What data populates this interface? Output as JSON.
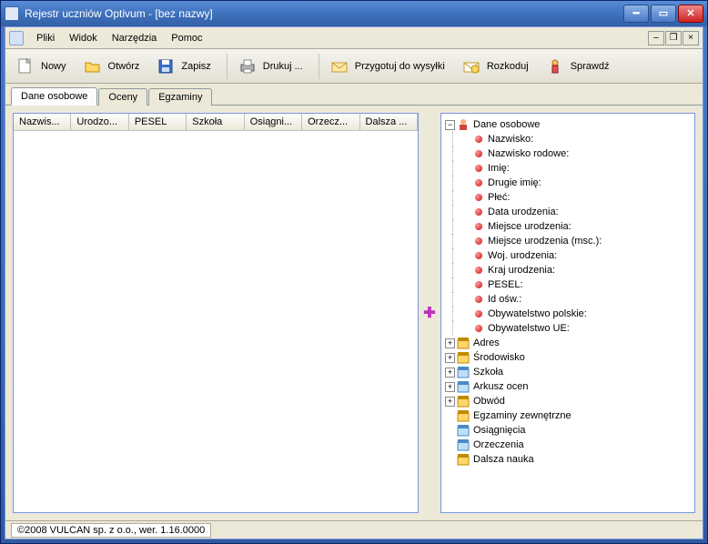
{
  "window": {
    "title": "Rejestr uczniów Optivum - [bez nazwy]"
  },
  "menu": {
    "items": [
      "Pliki",
      "Widok",
      "Narzędzia",
      "Pomoc"
    ]
  },
  "toolbar": {
    "nowy": "Nowy",
    "otworz": "Otwórz",
    "zapisz": "Zapisz",
    "drukuj": "Drukuj ...",
    "przygotuj": "Przygotuj do wysyłki",
    "rozkoduj": "Rozkoduj",
    "sprawdz": "Sprawdź"
  },
  "tabs": {
    "t0": "Dane osobowe",
    "t1": "Oceny",
    "t2": "Egzaminy"
  },
  "table": {
    "columns": [
      "Nazwis...",
      "Urodzo...",
      "PESEL",
      "Szkoła",
      "Osiągni...",
      "Orzecz...",
      "Dalsza ..."
    ]
  },
  "tree": {
    "root0": "Dane osobowe",
    "root0_children": [
      "Nazwisko:",
      "Nazwisko rodowe:",
      "Imię:",
      "Drugie imię:",
      "Płeć:",
      "Data urodzenia:",
      "Miejsce urodzenia:",
      "Miejsce urodzenia (msc.):",
      "Woj. urodzenia:",
      "Kraj urodzenia:",
      "PESEL:",
      "Id ośw.:",
      "Obywatelstwo polskie:",
      "Obywatelstwo UE:"
    ],
    "adres": "Adres",
    "srodowisko": "Środowisko",
    "szkola": "Szkoła",
    "arkusz": "Arkusz ocen",
    "obwod": "Obwód",
    "egzaminy": "Egzaminy zewnętrzne",
    "osiagniecia": "Osiągnięcia",
    "orzeczenia": "Orzeczenia",
    "dalsza": "Dalsza nauka"
  },
  "status": {
    "text": "©2008 VULCAN sp. z o.o., wer. 1.16.0000"
  }
}
